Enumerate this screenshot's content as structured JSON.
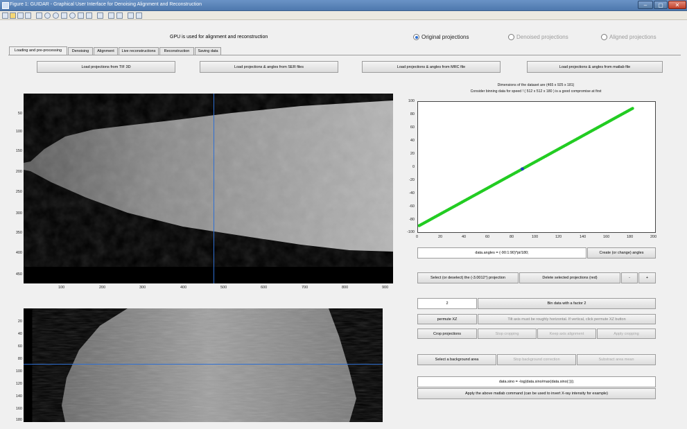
{
  "window": {
    "title": "Figure 1: GUIDAR - Graphical User Interface for Denoising Alignment and Reconstruction",
    "min": "–",
    "max": "▢",
    "close": "✕"
  },
  "gpu_status": "GPU is used for alignment and reconstruction",
  "projection_view": {
    "options": [
      "Original projections",
      "Denoised projections",
      "Aligned projections"
    ],
    "selected": "Original projections"
  },
  "tabs": [
    "Loading and pre-processing",
    "Denoising",
    "Alignment",
    "Live reconstructions",
    "Reconstruction",
    "Saving data"
  ],
  "active_tab": "Loading and pre-processing",
  "load_buttons": [
    "Load projections from TIF 3D",
    "Load projections & angles from SER files",
    "Load projections & angles from MRC file",
    "Load projections & angles from matlab file"
  ],
  "dataset_info": {
    "line1": "Dimensions of the dataset are (465 x 925 x 181)",
    "line2": "Consider binning data for speed ! ( 512 x 512 x 180 ) is a good compromise at first"
  },
  "projection_image": {
    "x_ticks": [
      "100",
      "200",
      "300",
      "400",
      "500",
      "600",
      "700",
      "800",
      "900"
    ],
    "y_ticks": [
      "50",
      "100",
      "150",
      "200",
      "250",
      "300",
      "350",
      "400",
      "450"
    ],
    "cursor_x": 476
  },
  "sinogram": {
    "y_ticks": [
      "20",
      "40",
      "60",
      "80",
      "100",
      "120",
      "140",
      "160",
      "180"
    ],
    "cursor_y": 88
  },
  "chart_data": {
    "type": "scatter",
    "x_ticks": [
      "0",
      "20",
      "40",
      "60",
      "80",
      "100",
      "120",
      "140",
      "160",
      "180",
      "200"
    ],
    "y_ticks": [
      "100",
      "80",
      "60",
      "40",
      "20",
      "0",
      "-20",
      "-40",
      "-60",
      "-80",
      "-100"
    ],
    "xlim": [
      0,
      200
    ],
    "ylim": [
      -100,
      100
    ],
    "series_color": "#22cc22",
    "selected_marker_color": "#1f3fbf",
    "x_start": 1,
    "x_end": 181,
    "x_step": 1,
    "y_start": -90,
    "y_step": 1,
    "selected_point": {
      "x": 88,
      "y": -3
    }
  },
  "angles": {
    "command": "data.angles = (-90:1:90)*pi/180;",
    "create_button": "Create (or change) angles"
  },
  "select_projection_button": "Select (or deselect) the (-3.0012°) projection",
  "delete_button": "Delete selected projections (red)",
  "nav": {
    "prev": "-",
    "next": "+"
  },
  "bin": {
    "value": "2",
    "button": "Bin data with a factor 2"
  },
  "permute": {
    "button": "permute XZ",
    "hint": "Tilt axis must be roughly horizontal. If vertical, click permute XZ button"
  },
  "crop": {
    "buttons": [
      "Crop projections",
      "Stop cropping",
      "Keep axis alignment",
      "Apply cropping"
    ]
  },
  "background": {
    "buttons": [
      "Select a background area",
      "Stop background correction",
      "Substract area mean"
    ]
  },
  "matlab": {
    "command": "data.sino = -log(data.sino/max(data.sino(:)));",
    "apply_button": "Apply the above matlab command (can be used to invert X-ray intensity for example)"
  }
}
